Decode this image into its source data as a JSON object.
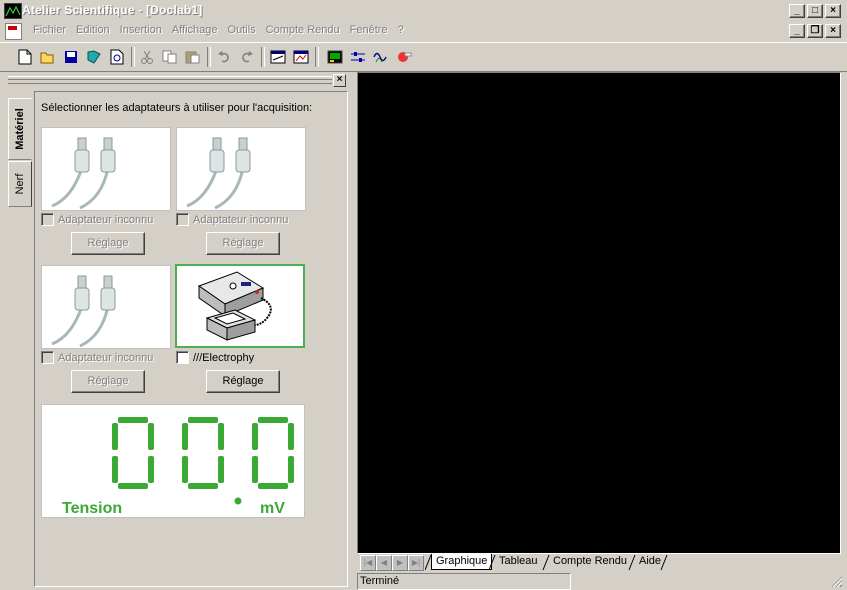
{
  "window": {
    "title": "Atelier Scientifique - [Doclab1]"
  },
  "menu": [
    "Fichier",
    "Edition",
    "Insertion",
    "Affichage",
    "Outils",
    "Compte Rendu",
    "Fenêtre",
    "?"
  ],
  "panel": {
    "side_tabs": [
      "Matériel",
      "Nerf"
    ],
    "instruction": "Sélectionner les adaptateurs à utiliser pour l'acquisition:",
    "adapters": [
      {
        "label": "Adaptateur inconnu",
        "button": "Réglage",
        "enabled": false
      },
      {
        "label": "Adaptateur inconnu",
        "button": "Réglage",
        "enabled": false
      },
      {
        "label": "Adaptateur inconnu",
        "button": "Réglage",
        "enabled": false
      },
      {
        "label": "///Electrophy",
        "button": "Réglage",
        "enabled": true
      }
    ],
    "display": {
      "value": "00.0",
      "label": "Tension",
      "unit": "mV",
      "color": "#3aaa35"
    }
  },
  "bottom_tabs": [
    "Graphique",
    "Tableau",
    "Compte Rendu",
    "Aide"
  ],
  "status": "Terminé"
}
